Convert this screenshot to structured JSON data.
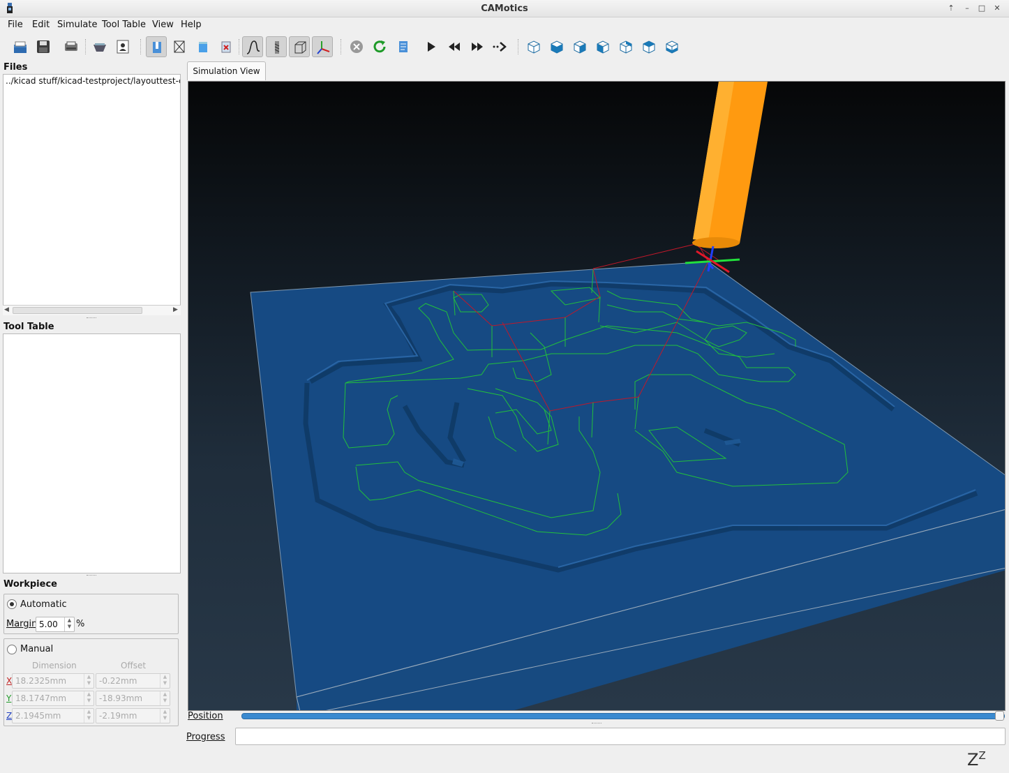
{
  "window": {
    "title": "CAMotics"
  },
  "menu": [
    "File",
    "Edit",
    "Simulate",
    "Tool Table",
    "View",
    "Help"
  ],
  "toolbar": {
    "buttons": [
      "open-icon",
      "save-icon",
      "export-icon",
      "tool-path-icon",
      "user-icon",
      "surface-icon",
      "wireframe-icon",
      "workpiece-icon",
      "remove-icon",
      "path-curve-icon",
      "tool-icon",
      "bbox-icon",
      "axes-icon",
      "stop-icon",
      "rerun-icon",
      "reload-icon",
      "play-icon",
      "rewind-icon",
      "fast-forward-icon",
      "step-icon",
      "iso-view-icon",
      "front-view-icon",
      "back-view-icon",
      "left-view-icon",
      "right-view-icon",
      "top-view-icon",
      "bottom-view-icon"
    ]
  },
  "files": {
    "title": "Files",
    "entries": [
      "../kicad stuff/kicad-testproject/layouttest-cnc"
    ]
  },
  "tool_table": {
    "title": "Tool Table"
  },
  "workpiece": {
    "title": "Workpiece",
    "automatic_label": "Automatic",
    "margin_label": "Margin",
    "margin_value": "5.00",
    "margin_unit": "%",
    "manual_label": "Manual",
    "dimension_header": "Dimension",
    "offset_header": "Offset",
    "rows": [
      {
        "axis": "X",
        "dimension": "18.2325mm",
        "offset": "-0.22mm"
      },
      {
        "axis": "Y",
        "dimension": "18.1747mm",
        "offset": "-18.93mm"
      },
      {
        "axis": "Z",
        "dimension": "2.1945mm",
        "offset": "-2.19mm"
      }
    ]
  },
  "view": {
    "tab_label": "Simulation View"
  },
  "position": {
    "label": "Position",
    "value": 1.0
  },
  "progress": {
    "label": "Progress"
  },
  "status": {
    "idle_glyph": "Z",
    "idle_glyph_sup": "Z"
  },
  "colors": {
    "accent": "#3a8ad0",
    "stock": "#1a4f88",
    "tool": "#ff9a10",
    "toolpath_cut": "#1fc43a",
    "toolpath_rapid": "#c0162a"
  }
}
